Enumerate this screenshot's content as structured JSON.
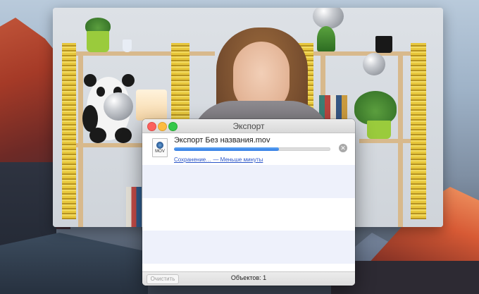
{
  "video": {},
  "dialog": {
    "title": "Экспорт",
    "item": {
      "icon_label": "MOV",
      "file_name": "Экспорт Без названия.mov",
      "progress": 0.67,
      "status": "Сохранение… — Меньше минуты"
    },
    "footer": {
      "clear_label": "Очистить",
      "count_text": "Объектов: 1"
    }
  },
  "colors": {
    "progress": "#2f7be4",
    "link": "#2a55c8",
    "close": "#fc605c",
    "minimize": "#fdbc40",
    "zoom": "#34c84a",
    "row_alt": "#eef1fb"
  }
}
